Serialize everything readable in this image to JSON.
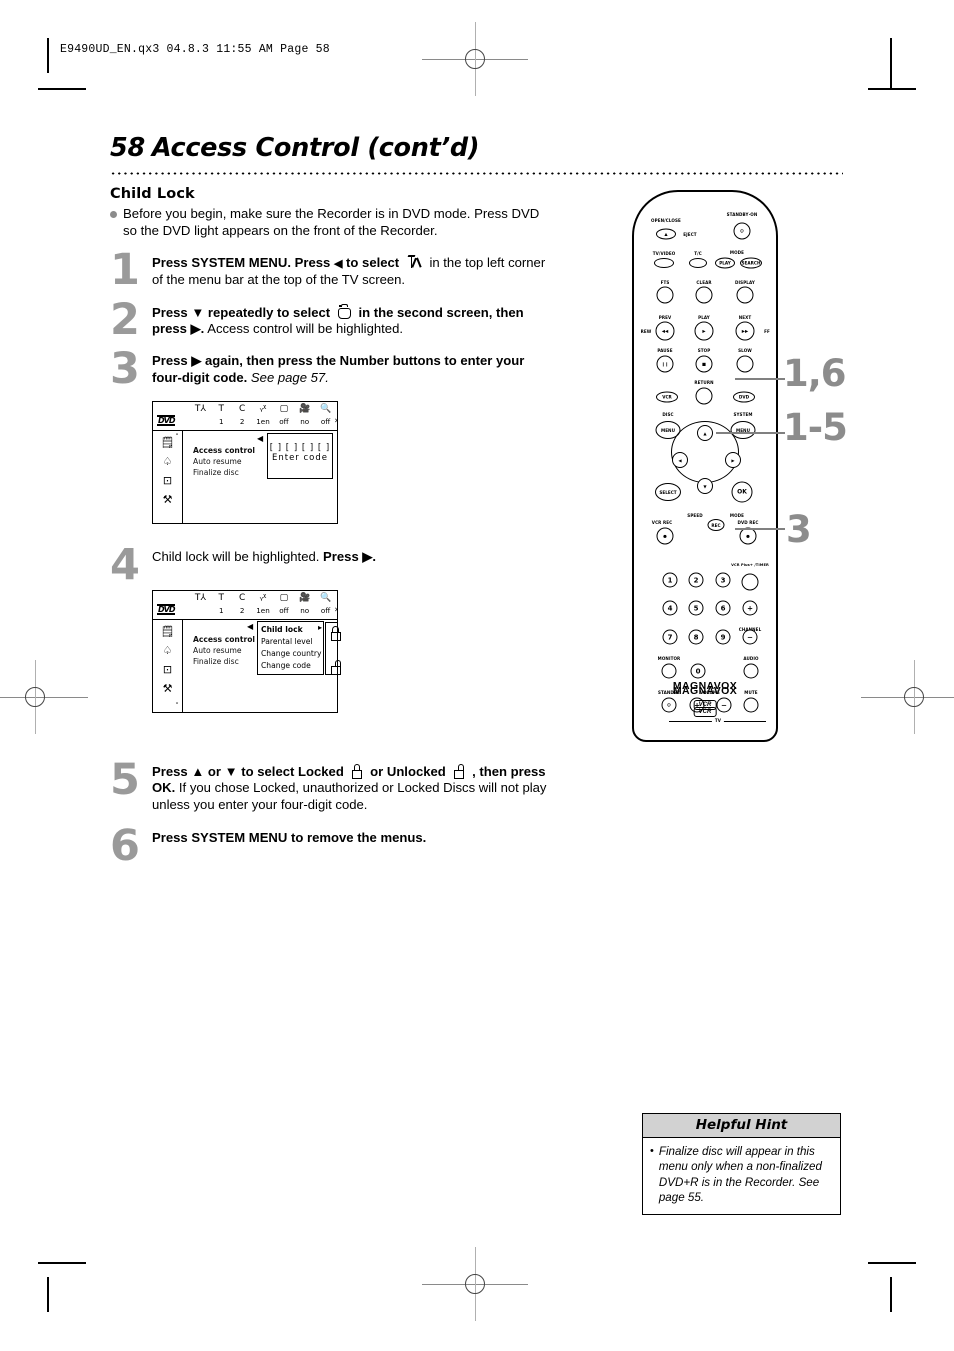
{
  "print_marks": {
    "file_stamp": "E9490UD_EN.qx3  04.8.3  11:55 AM  Page 58"
  },
  "page": {
    "number": "58",
    "title": "Access Control (cont’d)"
  },
  "section": {
    "heading": "Child Lock",
    "intro": "Before you begin, make sure the Recorder is in DVD mode. Press DVD so the DVD light appears on the front of the Recorder."
  },
  "steps": [
    {
      "number": "1",
      "bold_a": "Press SYSTEM MENU. Press ",
      "arrow": "◀",
      "bold_b": " to select",
      "after_glyph": "in the top left",
      "rest": "corner of the menu bar at the top of the TV screen."
    },
    {
      "number": "2",
      "bold_a": "Press ▼ repeatedly to select",
      "bold_b": "in the second screen, then press ▶.",
      "rest": " Access control will be highlighted."
    },
    {
      "number": "3",
      "bold_a": "Press ▶ again, then press the Number buttons to enter your four-digit code.",
      "italic": " See page 57."
    },
    {
      "number": "4",
      "plain": "Child lock will be highlighted. ",
      "bold_a": "Press ▶."
    },
    {
      "number": "5",
      "bold_a": "Press ▲ or ▼ to select Locked",
      "bold_b": "or Unlocked",
      "bold_c": ", then press OK.",
      "rest": " If you chose Locked, unauthorized or Locked Discs will not play unless you enter your four-digit code."
    },
    {
      "number": "6",
      "bold_a": "Press SYSTEM MENU to remove the menus."
    }
  ],
  "osd_menu_1": {
    "dvd_logo": "DVD",
    "bar_icons": [
      "antenna-icon",
      "T",
      "C",
      "subtitle-icon",
      "screen-icon",
      "camera-icon",
      "zoom-icon"
    ],
    "bar_values": [
      "",
      "1",
      "2",
      "1en",
      "off",
      "no",
      "off"
    ],
    "sidebar_icons": [
      "remote-icon",
      "child-lock-icon",
      "disc-icon",
      "wrench-icon"
    ],
    "rows": [
      "Access control",
      "Auto resume",
      "Finalize disc"
    ],
    "selected_row": "Access control",
    "code_mask": "[ ] [ ] [ ] [ ]",
    "code_label": "Enter code"
  },
  "osd_menu_2": {
    "dvd_logo": "DVD",
    "bar_icons": [
      "antenna-icon",
      "T",
      "C",
      "subtitle-icon",
      "screen-icon",
      "camera-icon",
      "zoom-icon"
    ],
    "bar_values": [
      "",
      "1",
      "2",
      "1en",
      "off",
      "no",
      "off"
    ],
    "sidebar_icons": [
      "remote-icon",
      "child-lock-icon",
      "disc-icon",
      "wrench-icon"
    ],
    "rows": [
      "Access control",
      "Auto resume",
      "Finalize disc"
    ],
    "selected_row": "Access control",
    "submenu_rows": [
      "Child lock",
      "Parental level",
      "Change country",
      "Change code"
    ],
    "submenu_selected": "Child lock",
    "lock_states": [
      "locked-icon",
      "unlocked-icon"
    ]
  },
  "remote": {
    "brand": "MAGNAVOX",
    "logo_badge": "VCR",
    "logo_badge_suffix": "Plus+",
    "labels": {
      "open_close": "OPEN/CLOSE",
      "eject": "EJECT",
      "standby_on": "STANDBY·ON",
      "tv_video": "TV/VIDEO",
      "t_c": "T/C",
      "mode": "MODE",
      "play_mode": "PLAY",
      "search_mode": "SEARCH",
      "fts": "FTS",
      "clear": "CLEAR",
      "display": "DISPLAY",
      "prev": "PREV",
      "play": "PLAY",
      "next": "NEXT",
      "rew": "REW",
      "ff": "FF",
      "pause": "PAUSE",
      "stop": "STOP",
      "slow": "SLOW",
      "return": "RETURN",
      "vcr": "VCR",
      "dvd": "DVD",
      "disc": "DISC",
      "disc_menu": "MENU",
      "system": "SYSTEM",
      "system_menu": "MENU",
      "select": "SELECT",
      "ok": "OK",
      "speed": "SPEED",
      "rec_mode": "MODE",
      "rec": "REC",
      "vcr_rec": "VCR REC",
      "dvd_rec": "DVD REC",
      "vcr_plus_timer": "VCR Plus+ /TIMER",
      "channel": "CHANNEL",
      "monitor": "MONITOR",
      "audio": "AUDIO",
      "standby": "STANDBY",
      "volume": "VOLUME",
      "mute": "MUTE",
      "tv": "TV"
    },
    "numbers": [
      "1",
      "2",
      "3",
      "4",
      "5",
      "6",
      "7",
      "8",
      "9",
      "0"
    ],
    "plus": "+",
    "minus": "−"
  },
  "callouts": [
    {
      "label": "1,6"
    },
    {
      "label": "1-5"
    },
    {
      "label": "3"
    }
  ],
  "helpful_hint": {
    "title": "Helpful Hint",
    "bullet": "•",
    "text": "Finalize disc will appear in this menu only when a non-finalized DVD+R is in the Recorder. See page 55."
  },
  "colors": {
    "step_number": "#9a9a9a",
    "callout": "#8c8c8c",
    "hint_header": "#d2d2d2"
  }
}
